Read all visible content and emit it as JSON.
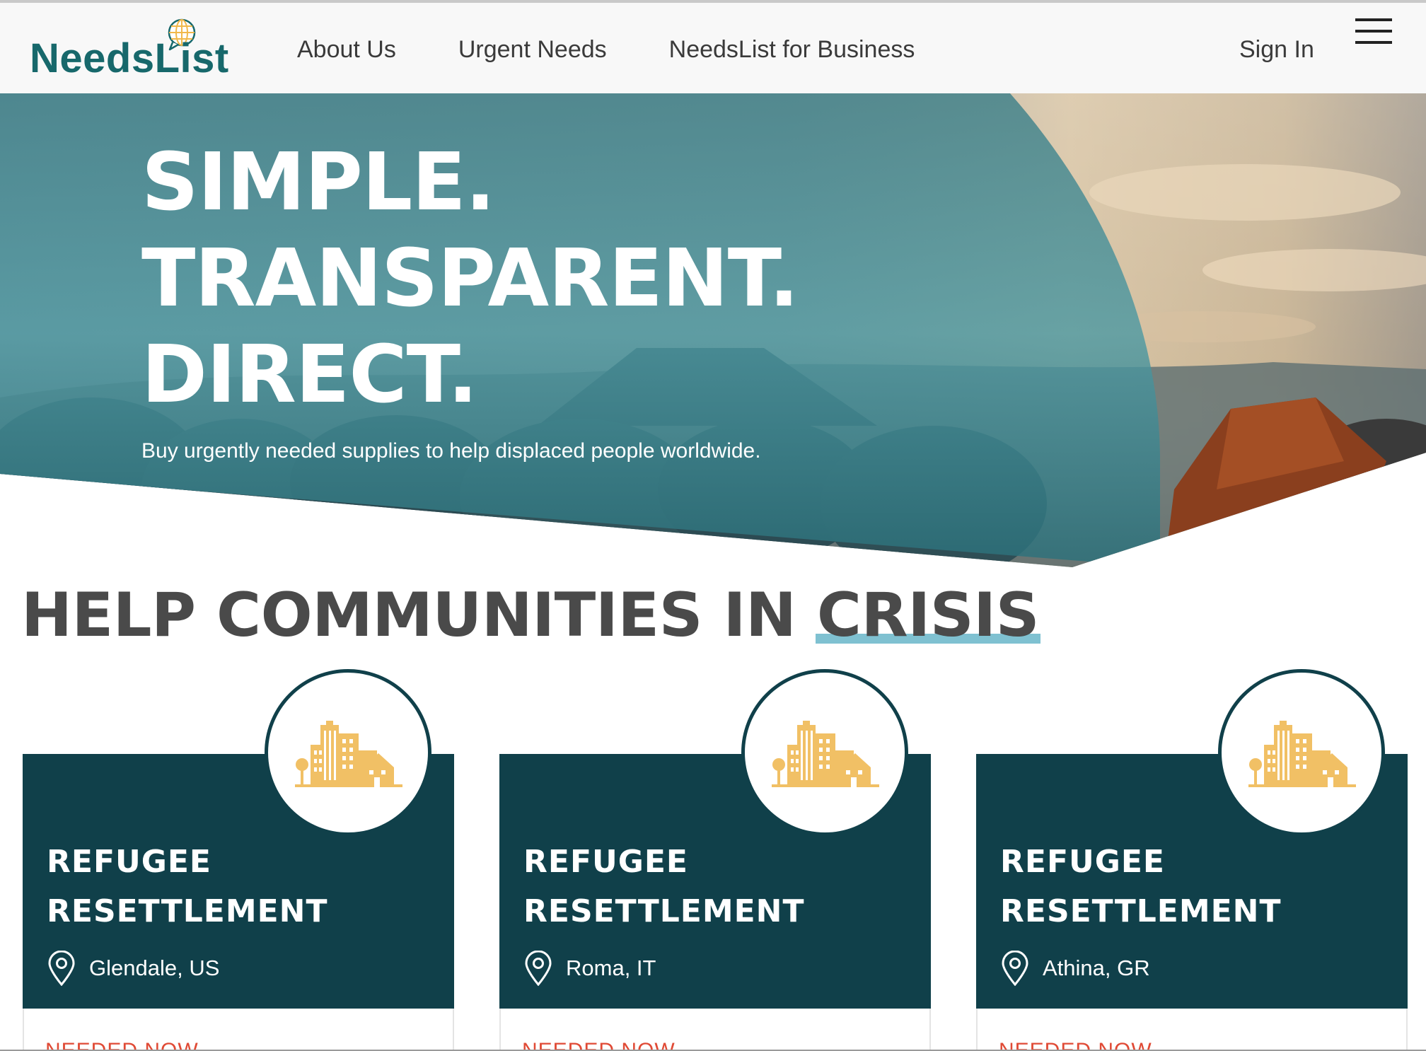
{
  "header": {
    "logo_text": "NeedsList",
    "nav": [
      "About Us",
      "Urgent Needs",
      "NeedsList for Business"
    ],
    "sign_in": "Sign In",
    "menu_icon": "hamburger-menu-icon"
  },
  "hero": {
    "line1": "SIMPLE.",
    "line2": "TRANSPARENT.",
    "line3": "DIRECT.",
    "subtitle": "Buy urgently needed supplies to help displaced people worldwide.",
    "colors": {
      "teal_overlay": "#2d7b84",
      "underline": "#f6a623"
    }
  },
  "section": {
    "title_prefix": "HELP COMMUNITIES IN ",
    "title_highlight": "CRISIS"
  },
  "cards": [
    {
      "title_line1": "REFUGEE",
      "title_line2": "RESETTLEMENT",
      "location": "Glendale, US",
      "status": "NEEDED NOW",
      "icon": "city-buildings-icon"
    },
    {
      "title_line1": "REFUGEE",
      "title_line2": "RESETTLEMENT",
      "location": "Roma, IT",
      "status": "NEEDED NOW",
      "icon": "city-buildings-icon"
    },
    {
      "title_line1": "REFUGEE",
      "title_line2": "RESETTLEMENT",
      "location": "Athina, GR",
      "status": "NEEDED NOW",
      "icon": "city-buildings-icon"
    }
  ],
  "colors": {
    "brand_teal": "#17686b",
    "card_dark": "#10404a",
    "building_yellow": "#f1c065",
    "status_red": "#e04a35",
    "crisis_underline": "#7fc1d1"
  }
}
